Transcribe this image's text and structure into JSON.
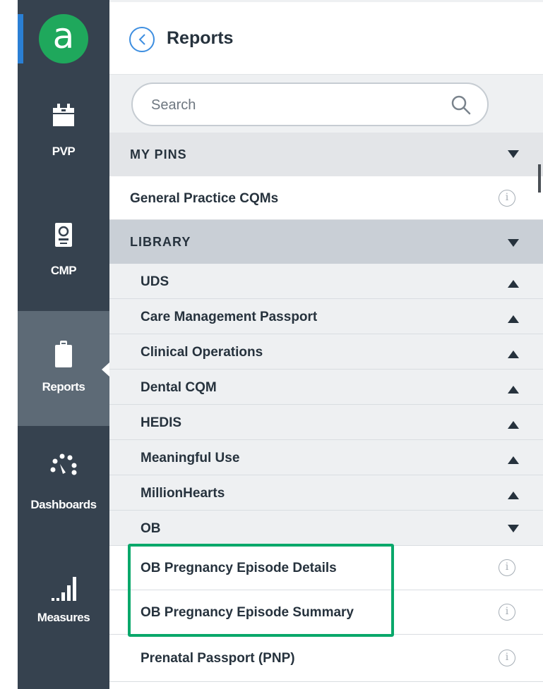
{
  "app": {
    "logo_letter": "a"
  },
  "nav": {
    "items": [
      {
        "label": "PVP",
        "icon": "calendar-icon",
        "active": false
      },
      {
        "label": "CMP",
        "icon": "passport-icon",
        "active": false
      },
      {
        "label": "Reports",
        "icon": "clipboard-icon",
        "active": true
      },
      {
        "label": "Dashboards",
        "icon": "gauge-icon",
        "active": false
      },
      {
        "label": "Measures",
        "icon": "signal-bars-icon",
        "active": false
      }
    ]
  },
  "header": {
    "title": "Reports",
    "back_icon": "chevron-left-icon"
  },
  "search": {
    "placeholder": "Search",
    "value": ""
  },
  "pins": {
    "label": "MY PINS",
    "items": [
      {
        "label": "General Practice CQMs"
      }
    ]
  },
  "library": {
    "label": "LIBRARY",
    "categories": [
      {
        "label": "UDS",
        "expanded": false
      },
      {
        "label": "Care Management Passport",
        "expanded": false
      },
      {
        "label": "Clinical Operations",
        "expanded": false
      },
      {
        "label": "Dental CQM",
        "expanded": false
      },
      {
        "label": "HEDIS",
        "expanded": false
      },
      {
        "label": "Meaningful Use",
        "expanded": false
      },
      {
        "label": "MillionHearts",
        "expanded": false
      },
      {
        "label": "OB",
        "expanded": true
      }
    ],
    "ob_reports": [
      {
        "label": "OB Pregnancy Episode Details"
      },
      {
        "label": "OB Pregnancy Episode Summary"
      },
      {
        "label": "Prenatal Passport (PNP)"
      }
    ]
  },
  "colors": {
    "rail": "#36424f",
    "rail_active": "#5d6a76",
    "logo": "#1fa85c",
    "accent_blue": "#2a7fd4",
    "highlight": "#0aa86b",
    "pins_header": "#e3e5e8",
    "library_header": "#c9cfd6"
  }
}
